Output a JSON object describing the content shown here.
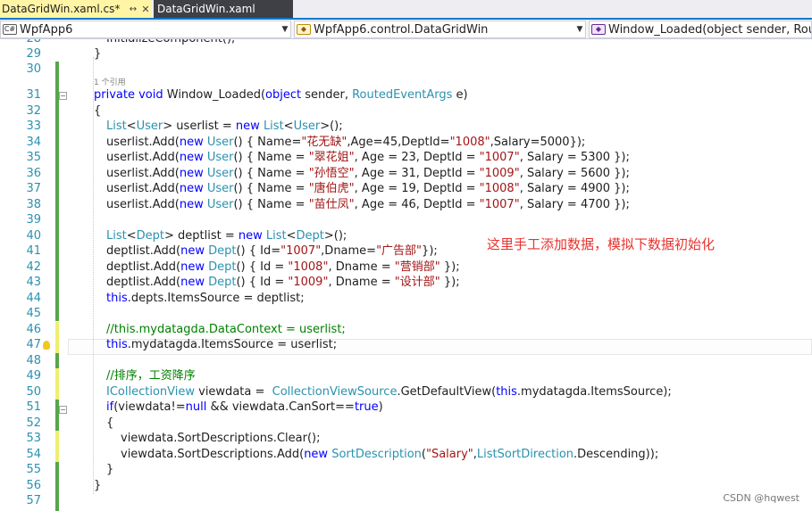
{
  "tabs": [
    {
      "label": "DataGridWin.xaml.cs*",
      "active": true
    },
    {
      "label": "DataGridWin.xaml",
      "active": false
    }
  ],
  "tab_pin_icon": "↔",
  "tab_close_icon": "✕",
  "navbar": {
    "project": "WpfApp6",
    "class": "WpfApp6.control.DataGridWin",
    "member": "Window_Loaded(object sender, RoutedEventArgs e)"
  },
  "code_lines": [
    {
      "n": "28",
      "segs": [
        {
          "t": "InitializeComponent();"
        }
      ]
    },
    {
      "n": "29",
      "segs": [
        {
          "t": "}"
        }
      ]
    },
    {
      "n": "30",
      "segs": []
    },
    {
      "n": "31",
      "segs": [
        {
          "t": "private void ",
          "c": "kw"
        },
        {
          "t": "Window_Loaded("
        },
        {
          "t": "object ",
          "c": "kw"
        },
        {
          "t": "sender, "
        },
        {
          "t": "RoutedEventArgs ",
          "c": "ty"
        },
        {
          "t": "e)"
        }
      ]
    },
    {
      "n": "32",
      "segs": [
        {
          "t": "{"
        }
      ]
    },
    {
      "n": "33",
      "segs": [
        {
          "t": "List",
          "c": "ty"
        },
        {
          "t": "<"
        },
        {
          "t": "User",
          "c": "ty"
        },
        {
          "t": "> userlist = "
        },
        {
          "t": "new ",
          "c": "kw"
        },
        {
          "t": "List",
          "c": "ty"
        },
        {
          "t": "<"
        },
        {
          "t": "User",
          "c": "ty"
        },
        {
          "t": ">();"
        }
      ]
    },
    {
      "n": "34",
      "segs": [
        {
          "t": "userlist.Add("
        },
        {
          "t": "new ",
          "c": "kw"
        },
        {
          "t": "User",
          "c": "ty"
        },
        {
          "t": "() { Name="
        },
        {
          "t": "\"花无缺\"",
          "c": "st"
        },
        {
          "t": ",Age=45,DeptId="
        },
        {
          "t": "\"1008\"",
          "c": "st"
        },
        {
          "t": ",Salary=5000});"
        }
      ]
    },
    {
      "n": "35",
      "segs": [
        {
          "t": "userlist.Add("
        },
        {
          "t": "new ",
          "c": "kw"
        },
        {
          "t": "User",
          "c": "ty"
        },
        {
          "t": "() { Name = "
        },
        {
          "t": "\"翠花姐\"",
          "c": "st"
        },
        {
          "t": ", Age = 23, DeptId = "
        },
        {
          "t": "\"1007\"",
          "c": "st"
        },
        {
          "t": ", Salary = 5300 });"
        }
      ]
    },
    {
      "n": "36",
      "segs": [
        {
          "t": "userlist.Add("
        },
        {
          "t": "new ",
          "c": "kw"
        },
        {
          "t": "User",
          "c": "ty"
        },
        {
          "t": "() { Name = "
        },
        {
          "t": "\"孙悟空\"",
          "c": "st"
        },
        {
          "t": ", Age = 31, DeptId = "
        },
        {
          "t": "\"1009\"",
          "c": "st"
        },
        {
          "t": ", Salary = 5600 });"
        }
      ]
    },
    {
      "n": "37",
      "segs": [
        {
          "t": "userlist.Add("
        },
        {
          "t": "new ",
          "c": "kw"
        },
        {
          "t": "User",
          "c": "ty"
        },
        {
          "t": "() { Name = "
        },
        {
          "t": "\"唐伯虎\"",
          "c": "st"
        },
        {
          "t": ", Age = 19, DeptId = "
        },
        {
          "t": "\"1008\"",
          "c": "st"
        },
        {
          "t": ", Salary = 4900 });"
        }
      ]
    },
    {
      "n": "38",
      "segs": [
        {
          "t": "userlist.Add("
        },
        {
          "t": "new ",
          "c": "kw"
        },
        {
          "t": "User",
          "c": "ty"
        },
        {
          "t": "() { Name = "
        },
        {
          "t": "\"苗仕凤\"",
          "c": "st"
        },
        {
          "t": ", Age = 46, DeptId = "
        },
        {
          "t": "\"1007\"",
          "c": "st"
        },
        {
          "t": ", Salary = 4700 });"
        }
      ]
    },
    {
      "n": "39",
      "segs": []
    },
    {
      "n": "40",
      "segs": [
        {
          "t": "List",
          "c": "ty"
        },
        {
          "t": "<"
        },
        {
          "t": "Dept",
          "c": "ty"
        },
        {
          "t": "> deptlist = "
        },
        {
          "t": "new ",
          "c": "kw"
        },
        {
          "t": "List",
          "c": "ty"
        },
        {
          "t": "<"
        },
        {
          "t": "Dept",
          "c": "ty"
        },
        {
          "t": ">();"
        }
      ]
    },
    {
      "n": "41",
      "segs": [
        {
          "t": "deptlist.Add("
        },
        {
          "t": "new ",
          "c": "kw"
        },
        {
          "t": "Dept",
          "c": "ty"
        },
        {
          "t": "() { Id="
        },
        {
          "t": "\"1007\"",
          "c": "st"
        },
        {
          "t": ",Dname="
        },
        {
          "t": "\"广告部\"",
          "c": "st"
        },
        {
          "t": "});"
        }
      ]
    },
    {
      "n": "42",
      "segs": [
        {
          "t": "deptlist.Add("
        },
        {
          "t": "new ",
          "c": "kw"
        },
        {
          "t": "Dept",
          "c": "ty"
        },
        {
          "t": "() { Id = "
        },
        {
          "t": "\"1008\"",
          "c": "st"
        },
        {
          "t": ", Dname = "
        },
        {
          "t": "\"营销部\"",
          "c": "st"
        },
        {
          "t": " });"
        }
      ]
    },
    {
      "n": "43",
      "segs": [
        {
          "t": "deptlist.Add("
        },
        {
          "t": "new ",
          "c": "kw"
        },
        {
          "t": "Dept",
          "c": "ty"
        },
        {
          "t": "() { Id = "
        },
        {
          "t": "\"1009\"",
          "c": "st"
        },
        {
          "t": ", Dname = "
        },
        {
          "t": "\"设计部\"",
          "c": "st"
        },
        {
          "t": " });"
        }
      ]
    },
    {
      "n": "44",
      "segs": [
        {
          "t": "this",
          "c": "kw"
        },
        {
          "t": ".depts.ItemsSource = deptlist;"
        }
      ]
    },
    {
      "n": "45",
      "segs": []
    },
    {
      "n": "46",
      "segs": [
        {
          "t": "//this.mydatagda.DataContext = userlist;",
          "c": "cm"
        }
      ]
    },
    {
      "n": "47",
      "segs": [
        {
          "t": "this",
          "c": "kw"
        },
        {
          "t": ".mydatagda.ItemsSource = userlist;"
        }
      ]
    },
    {
      "n": "48",
      "segs": []
    },
    {
      "n": "49",
      "segs": [
        {
          "t": "//排序，工资降序",
          "c": "cm"
        }
      ]
    },
    {
      "n": "50",
      "segs": [
        {
          "t": "ICollectionView ",
          "c": "ty"
        },
        {
          "t": "viewdata =  "
        },
        {
          "t": "CollectionViewSource",
          "c": "ty"
        },
        {
          "t": ".GetDefaultView("
        },
        {
          "t": "this",
          "c": "kw"
        },
        {
          "t": ".mydatagda.ItemsSource);"
        }
      ]
    },
    {
      "n": "51",
      "segs": [
        {
          "t": "if",
          "c": "kw"
        },
        {
          "t": "(viewdata!="
        },
        {
          "t": "null ",
          "c": "kw"
        },
        {
          "t": "&& viewdata.CanSort=="
        },
        {
          "t": "true",
          "c": "kw"
        },
        {
          "t": ")"
        }
      ]
    },
    {
      "n": "52",
      "segs": [
        {
          "t": "{"
        }
      ]
    },
    {
      "n": "53",
      "segs": [
        {
          "t": "viewdata.SortDescriptions.Clear();"
        }
      ]
    },
    {
      "n": "54",
      "segs": [
        {
          "t": "viewdata.SortDescriptions.Add("
        },
        {
          "t": "new ",
          "c": "kw"
        },
        {
          "t": "SortDescription",
          "c": "ty"
        },
        {
          "t": "("
        },
        {
          "t": "\"Salary\"",
          "c": "st"
        },
        {
          "t": ","
        },
        {
          "t": "ListSortDirection",
          "c": "ty"
        },
        {
          "t": ".Descending));"
        }
      ]
    },
    {
      "n": "55",
      "segs": [
        {
          "t": "}"
        }
      ]
    },
    {
      "n": "56",
      "segs": [
        {
          "t": "}"
        }
      ]
    },
    {
      "n": "57",
      "segs": []
    }
  ],
  "reference_hint": "1 个引用",
  "annotation": "这里手工添加数据，模拟下数据初始化",
  "watermark": "CSDN @hqwest",
  "colors": {
    "keyword": "#0000ff",
    "type": "#2b91af",
    "string": "#a31515",
    "comment": "#008000",
    "annotation": "#e8322e",
    "active_tab": "#fff5a5",
    "change_saved": "#57a64a",
    "change_unsaved": "#efef6e"
  },
  "icons": {
    "project_combo": "csharp-project-icon",
    "class_combo": "class-icon",
    "member_combo": "method-icon",
    "lightbulb": "lightbulb-icon",
    "dropdown": "chevron-down-icon"
  }
}
